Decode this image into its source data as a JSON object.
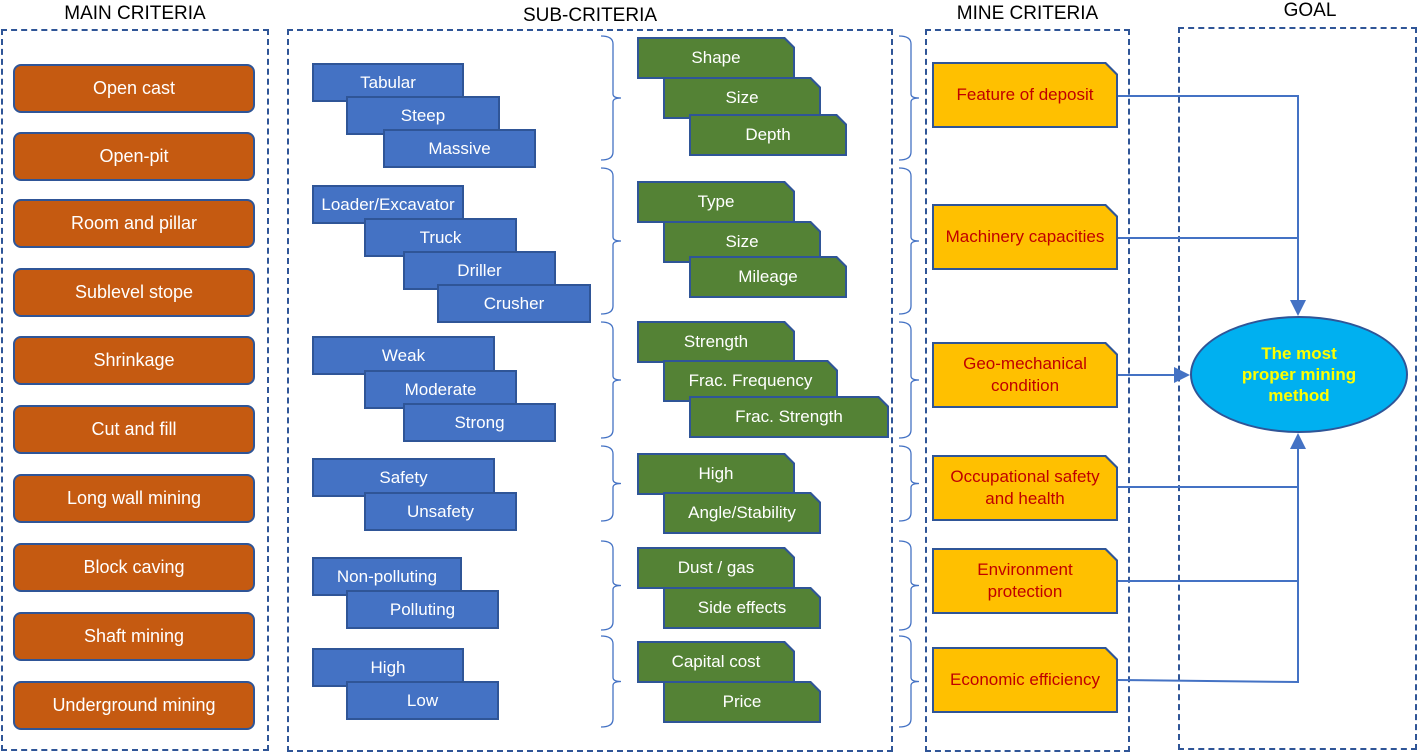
{
  "headings": {
    "main_criteria": "MAIN CRITERIA",
    "sub_criteria": "SUB-CRITERIA",
    "mine_criteria": "MINE CRITERIA",
    "goal": "GOAL"
  },
  "main_criteria": [
    "Open cast",
    "Open-pit",
    "Room and pillar",
    "Sublevel stope",
    "Shrinkage",
    "Cut and fill",
    "Long wall mining",
    "Block caving",
    "Shaft mining",
    "Underground mining"
  ],
  "sub_criteria_groups": [
    {
      "levels": [
        "Tabular",
        "Steep",
        "Massive"
      ],
      "factors": [
        "Shape",
        "Size",
        "Depth"
      ]
    },
    {
      "levels": [
        "Loader/Excavator",
        "Truck",
        "Driller",
        "Crusher"
      ],
      "factors": [
        "Type",
        "Size",
        "Mileage"
      ]
    },
    {
      "levels": [
        "Weak",
        "Moderate",
        "Strong"
      ],
      "factors": [
        "Strength",
        "Frac. Frequency",
        "Frac. Strength"
      ]
    },
    {
      "levels": [
        "Safety",
        "Unsafety"
      ],
      "factors": [
        "High",
        "Angle/Stability"
      ]
    },
    {
      "levels": [
        "Non-polluting",
        "Polluting"
      ],
      "factors": [
        "Dust / gas",
        "Side effects"
      ]
    },
    {
      "levels": [
        "High",
        "Low"
      ],
      "factors": [
        "Capital cost",
        "Price"
      ]
    }
  ],
  "mine_criteria": [
    "Feature of deposit",
    "Machinery capacities",
    "Geo-mechanical condition",
    "Occupational safety and health",
    "Environment protection",
    "Economic efficiency"
  ],
  "goal": "The most proper mining method",
  "colors": {
    "panel_border": "#2f5597",
    "main_box": "#c55a11",
    "level_box": "#4472c4",
    "factor_box": "#548235",
    "mine_box": "#ffc000",
    "mine_text": "#c00000",
    "goal_fill": "#00b0f0",
    "goal_text": "#ffff00",
    "connector": "#4472c4"
  }
}
